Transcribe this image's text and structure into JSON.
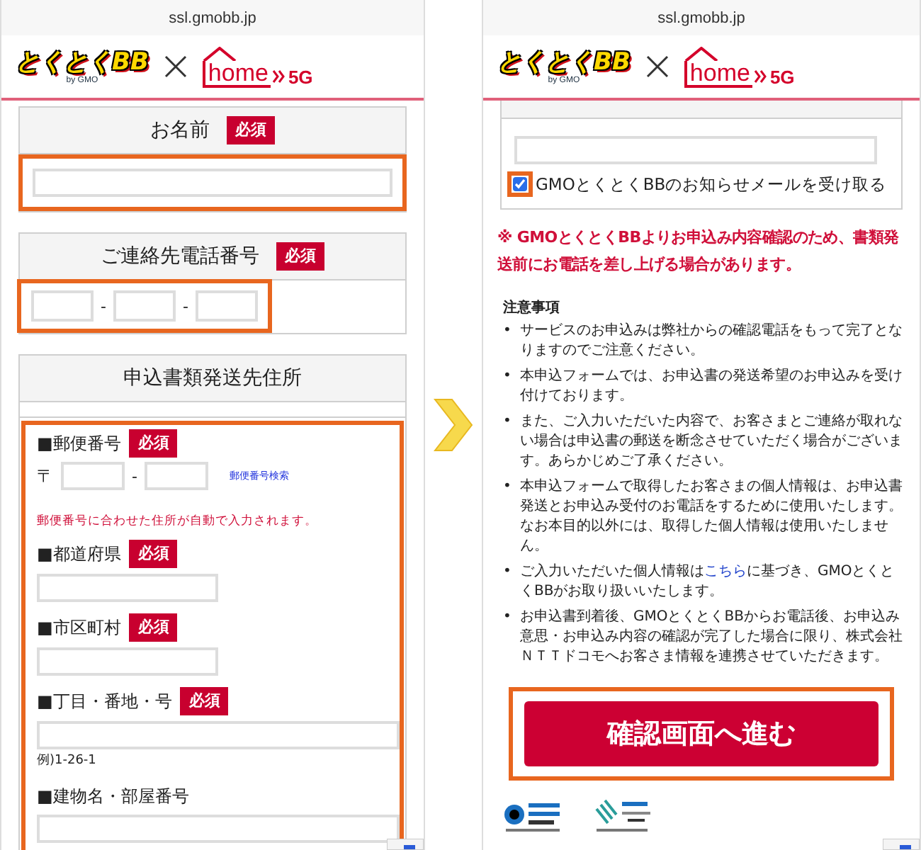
{
  "left_screen": {
    "url": "ssl.gmobb.jp",
    "logo": {
      "brand": "とくとくBB",
      "brand_sub": "by GMO",
      "partner": "home",
      "partner_suffix": "5G"
    },
    "name_section": {
      "title": "お名前",
      "badge": "必須",
      "highlighted": true
    },
    "phone_section": {
      "title": "ご連絡先電話番号",
      "badge": "必須",
      "separators": [
        "-",
        "-"
      ],
      "highlighted": true
    },
    "address_section": {
      "title": "申込書類発送先住所",
      "highlighted": true,
      "postal": {
        "label": "■郵便番号",
        "badge": "必須",
        "prefix": "〒",
        "separator": "-",
        "link": "郵便番号検索"
      },
      "note": "郵便番号に合わせた住所が自動で入力されます。",
      "fields": [
        {
          "label": "■都道府県",
          "badge": "必須",
          "kind": "short"
        },
        {
          "label": "■市区町村",
          "badge": "必須",
          "kind": "short"
        },
        {
          "label": "■丁目・番地・号",
          "badge": "必須",
          "kind": "long",
          "hint": "例)1-26-1"
        },
        {
          "label": "■建物名・部屋番号",
          "kind": "long"
        }
      ]
    }
  },
  "right_screen": {
    "url": "ssl.gmobb.jp",
    "logo": {
      "brand": "とくとくBB",
      "brand_sub": "by GMO",
      "partner": "home",
      "partner_suffix": "5G"
    },
    "mail_option": {
      "label": "GMOとくとくBBのお知らせメールを受け取る",
      "checked": true,
      "highlighted": true
    },
    "notice": "※ GMOとくとくBBよりお申込み内容確認のため、書類発送前にお電話を差し上げる場合があります。",
    "notes_title": "注意事項",
    "notes": [
      {
        "bullet": "•",
        "text": "サービスのお申込みは弊社からの確認電話をもって完了となりますのでご注意ください。"
      },
      {
        "bullet": "•",
        "text": "本申込フォームでは、お申込書の発送希望のお申込みを受け付けております。"
      },
      {
        "bullet": "•",
        "text": "また、ご入力いただいた内容で、お客さまとご連絡が取れない場合は申込書の郵送を断念させていただく場合がございます。あらかじめご了承ください。"
      },
      {
        "bullet": "•",
        "text": "本申込フォームで取得したお客さまの個人情報は、お申込書発送とお申込み受付のお電話をするために使用いたします。なお本目的以外には、取得した個人情報は使用いたしません。"
      },
      {
        "bullet": "•",
        "text": "ご入力いただいた個人情報は",
        "link": "こちら",
        "text_after": "に基づき、GMOとくとくBBがお取り扱いいたします。"
      },
      {
        "bullet": "•",
        "text": "お申込書到着後、GMOとくとくBBからお電話後、お申込み意思・お申込み内容の確認が完了した場合に限り、株式会社ＮＴＴドコモへお客さま情報を連携させていただきます。"
      }
    ],
    "submit": {
      "label": "確認画面へ進む",
      "highlighted": true
    }
  }
}
